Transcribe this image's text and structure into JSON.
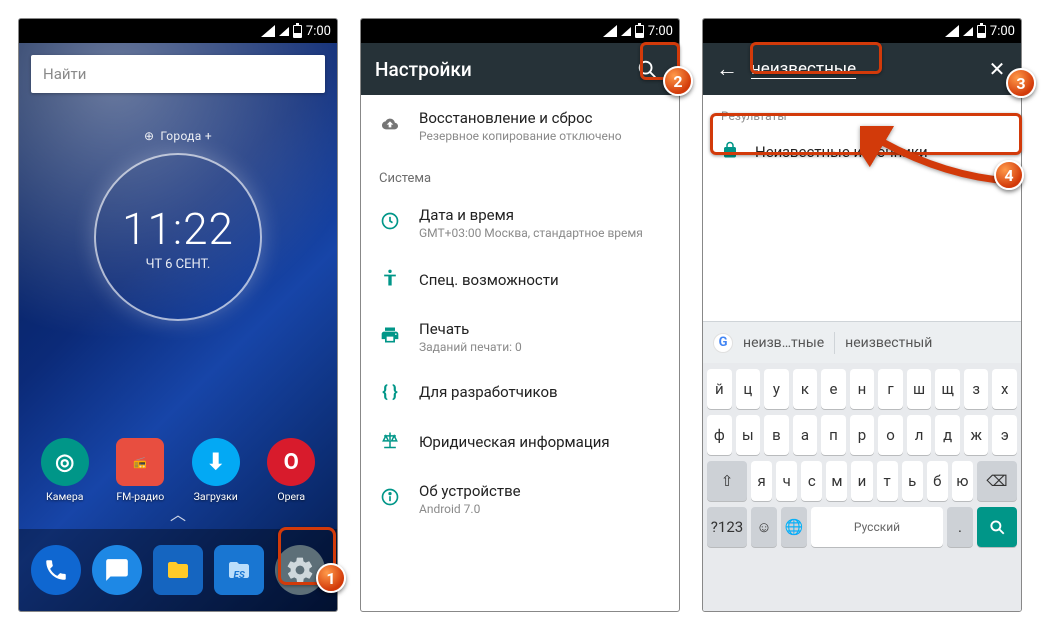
{
  "status": {
    "time": "7:00"
  },
  "screen1": {
    "search_placeholder": "Найти",
    "city": "Города +",
    "clock_time": "11:22",
    "clock_date": "ЧТ 6 СЕНТ.",
    "apps": [
      {
        "label": "Камера"
      },
      {
        "label": "FM-радио"
      },
      {
        "label": "Загрузки"
      },
      {
        "label": "Opera"
      }
    ]
  },
  "screen2": {
    "title": "Настройки",
    "item_backup": {
      "title": "Восстановление и сброс",
      "subtitle": "Резервное копирование отключено"
    },
    "section_system": "Система",
    "item_date": {
      "title": "Дата и время",
      "subtitle": "GMT+03:00 Москва, стандартное время"
    },
    "item_access": {
      "title": "Спец. возможности"
    },
    "item_print": {
      "title": "Печать",
      "subtitle": "Заданий печати: 0"
    },
    "item_dev": {
      "title": "Для разработчиков"
    },
    "item_legal": {
      "title": "Юридическая информация"
    },
    "item_about": {
      "title": "Об устройстве",
      "subtitle": "Android 7.0"
    }
  },
  "screen3": {
    "query": "неизвестные",
    "results_label": "Результаты",
    "result1": "Неизвестные источники",
    "suggest1": "неизв…тные",
    "suggest2": "неизвестный",
    "space_label": "Русский",
    "num_key": "?123",
    "kb_rows": [
      [
        "й",
        "ц",
        "у",
        "к",
        "е",
        "н",
        "г",
        "ш",
        "щ",
        "з",
        "х"
      ],
      [
        "ф",
        "ы",
        "в",
        "а",
        "п",
        "р",
        "о",
        "л",
        "д",
        "ж",
        "э"
      ],
      [
        "⇧",
        "я",
        "ч",
        "с",
        "м",
        "и",
        "т",
        "ь",
        "б",
        "ю",
        "⌫"
      ]
    ]
  }
}
